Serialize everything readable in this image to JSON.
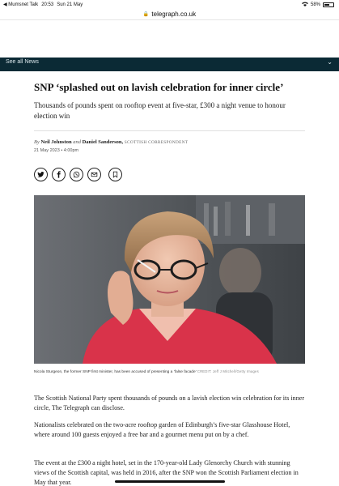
{
  "status_bar": {
    "back_app": "◀ Mumsnet Talk",
    "time": "20:53",
    "date": "Sun 21 May",
    "battery": "58%"
  },
  "browser": {
    "url": "telegraph.co.uk"
  },
  "nav": {
    "label": "See all News"
  },
  "article": {
    "headline": "SNP ‘splashed out on lavish celebration for inner circle’",
    "standfirst": "Thousands of pounds spent on rooftop event at five-star, £300 a night venue to honour election win",
    "byline": {
      "by": "By",
      "author1": "Neil Johnston",
      "and": "and",
      "author2": "Daniel Sanderson,",
      "role": "SCOTTISH CORRESPONDENT"
    },
    "datetime": "21 May 2023 • 4:00pm",
    "share_icons": [
      "twitter-icon",
      "facebook-icon",
      "whatsapp-icon",
      "email-icon",
      "bookmark-icon"
    ],
    "image_caption": "Nicola Sturgeon, the former SNP first minister, has been accused of presenting a ‘false facade’",
    "image_credit": "CREDIT: Jeff J Mitchell/Getty Images",
    "paragraphs": [
      "The Scottish National Party spent thousands of pounds on a lavish election win celebration for its inner circle, The Telegraph can disclose.",
      "Nationalists celebrated on the two-acre rooftop garden of Edinburgh’s five-star Glasshouse Hotel, where around 100 guests enjoyed a free bar and a gourmet menu put on by a chef.",
      "The event at the £300 a night hotel, set in the 170-year-old Lady Glenorchy Church with stunning views of the Scottish capital, was held in 2016, after the SNP won the Scottish Parliament election in May that year."
    ]
  },
  "colors": {
    "nav_bg": "#0b2a35",
    "text": "#111111"
  }
}
